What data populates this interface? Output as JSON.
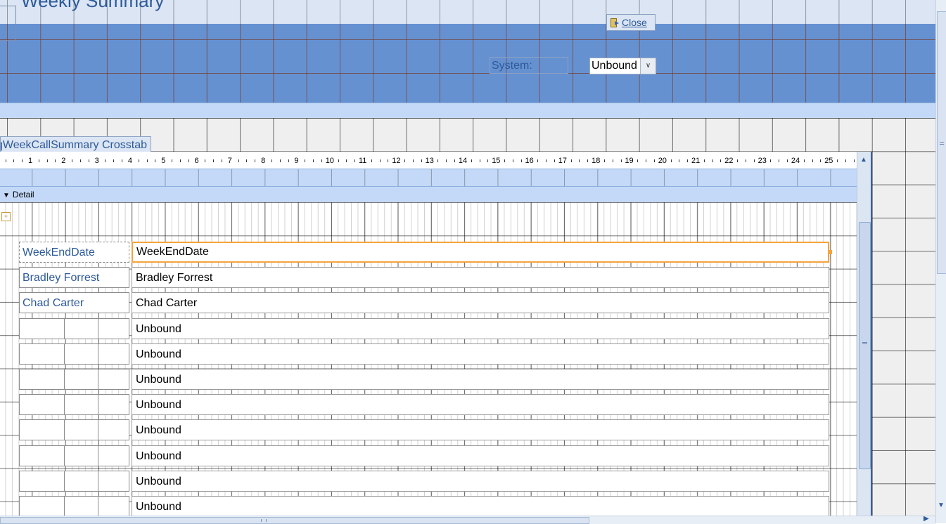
{
  "form_header": {
    "title": "Weekly Summary",
    "close_label": "Close",
    "system_label": "System:",
    "system_value": "Unbound"
  },
  "subform": {
    "tab_label": "qWeekCallSummary Crosstab",
    "detail_label": "Detail",
    "ruler_numbers": [
      "1",
      "2",
      "3",
      "4",
      "5",
      "6",
      "7",
      "8",
      "9",
      "10",
      "11",
      "12",
      "13",
      "14",
      "15",
      "16",
      "17",
      "18",
      "19",
      "20",
      "21",
      "22",
      "23",
      "24",
      "25"
    ],
    "rows": [
      {
        "label": "WeekEndDate",
        "field": "WeekEndDate"
      },
      {
        "label": "Bradley Forrest",
        "field": "Bradley Forrest"
      },
      {
        "label": "Chad Carter",
        "field": "Chad Carter"
      },
      {
        "label": "",
        "field": "Unbound"
      },
      {
        "label": "",
        "field": "Unbound"
      },
      {
        "label": "",
        "field": "Unbound"
      },
      {
        "label": "",
        "field": "Unbound"
      },
      {
        "label": "",
        "field": "Unbound"
      },
      {
        "label": "",
        "field": "Unbound"
      },
      {
        "label": "",
        "field": "Unbound"
      },
      {
        "label": "",
        "field": "Unbound"
      }
    ]
  },
  "colors": {
    "header_blue": "#6691d1",
    "section_bar": "#c3d9f7",
    "selection_orange": "#f4a43b",
    "label_text": "#2d5a9a"
  }
}
